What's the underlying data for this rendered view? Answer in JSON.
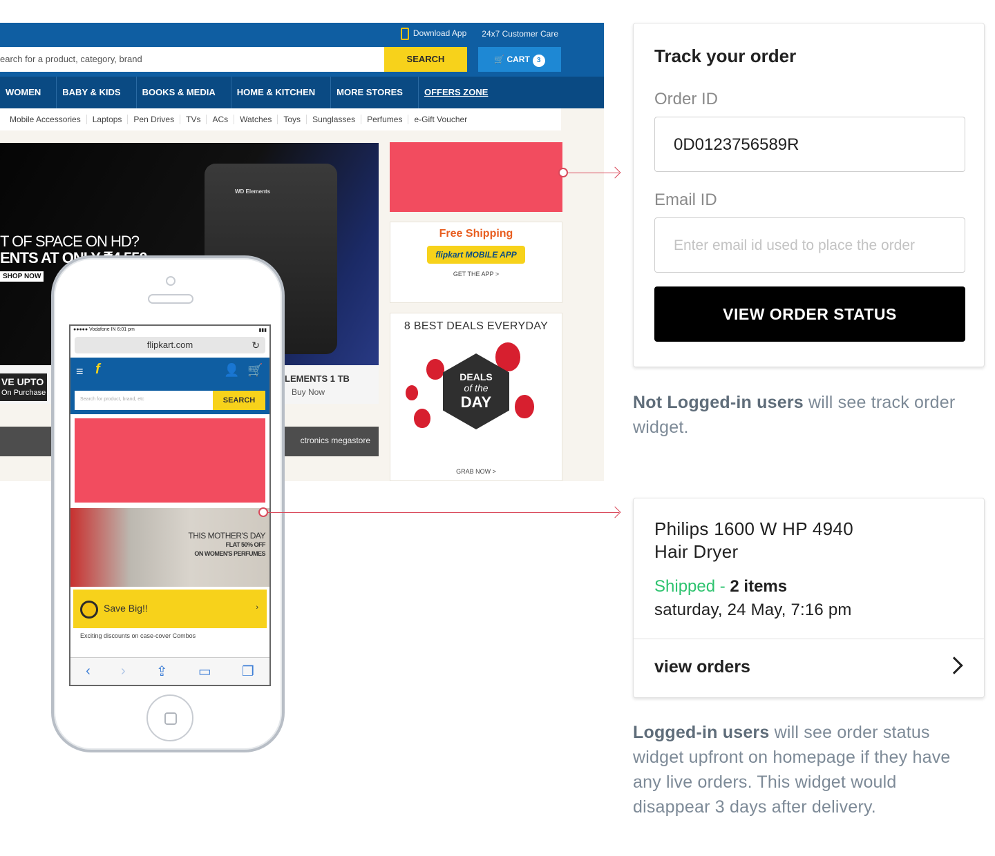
{
  "desktop": {
    "topbar": {
      "download_app": "Download App",
      "customer_care": "24x7 Customer Care"
    },
    "search": {
      "placeholder": "earch for a product, category, brand",
      "button": "SEARCH"
    },
    "cart": {
      "label": "CART",
      "count": "3"
    },
    "nav": [
      "WOMEN",
      "BABY & KIDS",
      "BOOKS & MEDIA",
      "HOME & KITCHEN",
      "MORE STORES",
      "OFFERS ZONE"
    ],
    "subnav": [
      "Mobile Accessories",
      "Laptops",
      "Pen Drives",
      "TVs",
      "ACs",
      "Watches",
      "Toys",
      "Sunglasses",
      "Perfumes",
      "e-Gift Voucher"
    ],
    "hero": {
      "line1": "T OF SPACE ON HD?",
      "line2": "ENTS AT ONLY ₹4,550",
      "shop_now": "SHOP NOW",
      "hdd_label": "WD Elements",
      "save_upto": "VE UPTO",
      "on_purchase": "On Purchase",
      "wd_caption": "LEMENTS 1 TB",
      "buy_now": "Buy Now",
      "megastore": "ctronics megastore"
    },
    "promo_ship": {
      "title": "Free Shipping",
      "app": "flipkart MOBILE APP",
      "cta": "GET THE APP >"
    },
    "promo_deals": {
      "title": "8 BEST DEALS EVERYDAY",
      "deals": "DEALS",
      "of_the": "of the",
      "day": "DAY",
      "cta": "GRAB NOW >"
    }
  },
  "phone": {
    "status_left": "●●●●● Vodafone IN  6:01 pm",
    "url": "flipkart.com",
    "search_placeholder": "Search for product, brand, etc",
    "search_button": "SEARCH",
    "banner_line1": "THIS MOTHER'S DAY",
    "banner_line2": "FLAT 50% OFF",
    "banner_line3": "ON WOMEN'S PERFUMES",
    "save_big": "Save Big!!",
    "exciting": "Exciting discounts on case-cover Combos"
  },
  "track": {
    "title": "Track your order",
    "order_label": "Order ID",
    "order_value": "0D0123756589R",
    "email_label": "Email ID",
    "email_placeholder": "Enter email id used to place the order",
    "button": "VIEW ORDER STATUS"
  },
  "note1": {
    "bold": "Not Logged-in users",
    "rest": " will see track order widget."
  },
  "order": {
    "name_line1": "Philips 1600 W HP 4940",
    "name_line2": "Hair Dryer",
    "status": "Shipped - ",
    "items": "2 items",
    "date": "saturday, 24 May, 7:16 pm",
    "view_orders": "view orders"
  },
  "note2": {
    "bold": "Logged-in users",
    "rest": " will see order status widget upfront on homepage if they have any live orders. This widget would disappear 3 days after delivery."
  },
  "colors": {
    "brand_blue": "#0f5ea2",
    "brand_yellow": "#f7d21b",
    "highlight_red": "#f24c5f",
    "shipped_green": "#2ec36f",
    "connector": "#d9485a"
  }
}
